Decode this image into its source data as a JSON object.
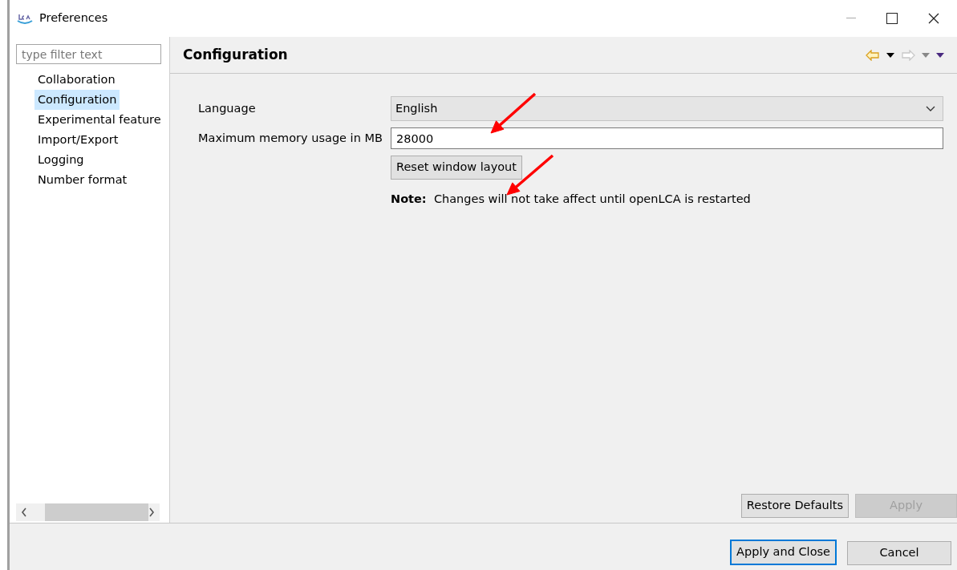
{
  "window": {
    "title": "Preferences"
  },
  "filter": {
    "placeholder": "type filter text"
  },
  "tree": [
    {
      "label": "Collaboration",
      "selected": false
    },
    {
      "label": "Configuration",
      "selected": true
    },
    {
      "label": "Experimental feature",
      "selected": false
    },
    {
      "label": "Import/Export",
      "selected": false
    },
    {
      "label": "Logging",
      "selected": false
    },
    {
      "label": "Number format",
      "selected": false
    }
  ],
  "page": {
    "title": "Configuration",
    "nav": {
      "back_enabled": true,
      "forward_enabled": false
    },
    "fields": [
      {
        "kind": "select",
        "label": "Language",
        "value": "English"
      },
      {
        "kind": "text",
        "label": "Maximum memory usage in MB",
        "value": "28000"
      }
    ],
    "reset_button": "Reset window layout",
    "note": "**Note:**  Changes will not take affect until openLCA is restarted"
  },
  "page_buttons": [
    {
      "label": "Restore Defaults",
      "disabled": false
    },
    {
      "label": "Apply",
      "disabled": true
    }
  ],
  "dialog_buttons": [
    {
      "label": "Apply and Close",
      "default": true
    },
    {
      "label": "Cancel",
      "default": false
    }
  ],
  "annotations": [
    {
      "kind": "arrow",
      "color": "#ff0000"
    },
    {
      "kind": "arrow",
      "color": "#ff0000"
    }
  ]
}
